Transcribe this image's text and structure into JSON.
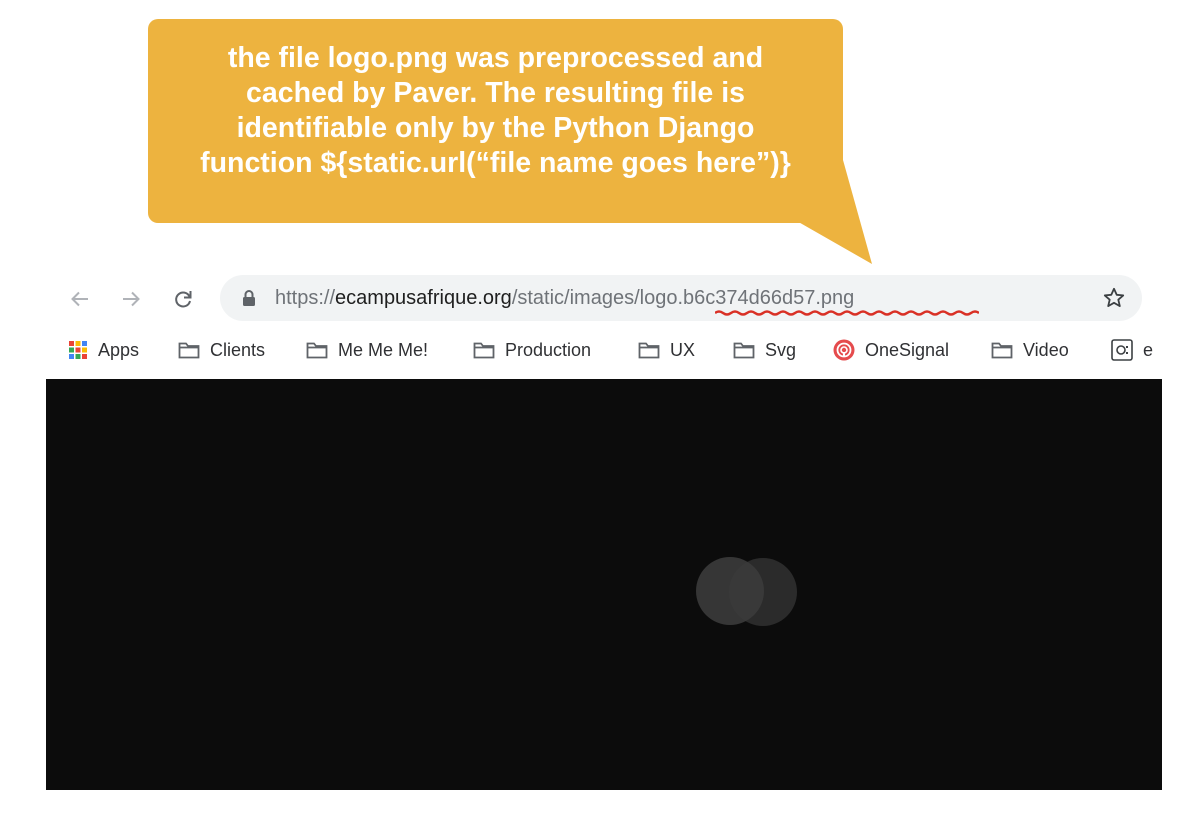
{
  "callout": {
    "lines": [
      "the file logo.png was preprocessed and",
      "cached by Paver. The resulting file is",
      "identifiable only by the Python Django",
      "function ${static.url(“file name goes here”)}"
    ],
    "color": "#edb33f"
  },
  "toolbar": {
    "back_icon": "arrow-left-icon",
    "forward_icon": "arrow-right-icon",
    "reload_icon": "reload-icon",
    "lock_icon": "lock-icon",
    "star_icon": "star-icon",
    "url": {
      "scheme": "https://",
      "host": "ecampusafrique.org",
      "path": "/static/images/",
      "file": "logo.b6c374d66d57.png"
    }
  },
  "bookmarks": {
    "items": [
      {
        "label": "Apps",
        "icon": "apps-grid-icon"
      },
      {
        "label": "Clients",
        "icon": "folder-icon"
      },
      {
        "label": "Me Me Me!",
        "icon": "folder-icon"
      },
      {
        "label": "Production",
        "icon": "folder-icon"
      },
      {
        "label": "UX",
        "icon": "folder-icon"
      },
      {
        "label": "Svg",
        "icon": "folder-icon"
      },
      {
        "label": "OneSignal",
        "icon": "onesignal-icon"
      },
      {
        "label": "Video",
        "icon": "folder-icon"
      },
      {
        "label": "e",
        "icon": "page-icon"
      }
    ]
  },
  "colors": {
    "underline": "#d93025",
    "page_background": "#0c0c0c"
  }
}
